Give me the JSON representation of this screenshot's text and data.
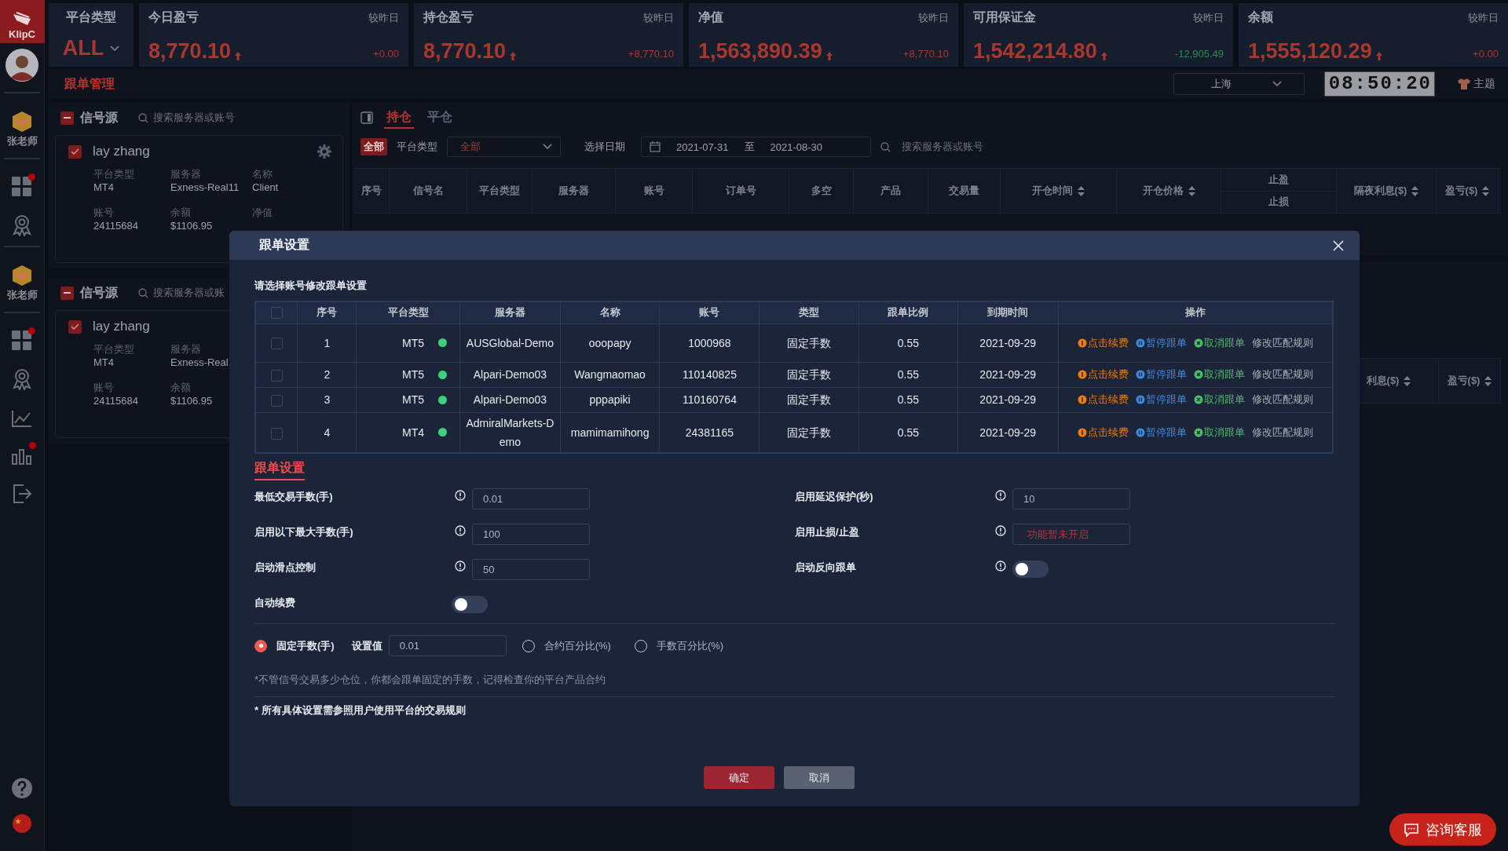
{
  "nav": {
    "logo": "KlipC",
    "items": [
      {
        "kind": "avatar"
      },
      {
        "kind": "teacher",
        "label": "张老师"
      },
      {
        "kind": "grid",
        "badge": true
      },
      {
        "kind": "award"
      },
      {
        "kind": "teacher",
        "label": "张老师"
      },
      {
        "kind": "grid",
        "badge": true
      },
      {
        "kind": "award"
      },
      {
        "kind": "chart"
      },
      {
        "kind": "bars",
        "badge": true
      },
      {
        "kind": "logout"
      }
    ],
    "bottom": [
      {
        "kind": "help"
      },
      {
        "kind": "flag"
      }
    ]
  },
  "platform_card": {
    "title": "平台类型",
    "value": "ALL"
  },
  "stats": [
    {
      "title": "今日盈亏",
      "compare": "较昨日",
      "value": "8,770.10",
      "rising": true,
      "delta": "+0.00",
      "delta_negative": false
    },
    {
      "title": "持仓盈亏",
      "compare": "较昨日",
      "value": "8,770.10",
      "rising": true,
      "delta": "+8,770.10",
      "delta_negative": false
    },
    {
      "title": "净值",
      "compare": "较昨日",
      "value": "1,563,890.39",
      "rising": true,
      "delta": "+8,770.10",
      "delta_negative": false
    },
    {
      "title": "可用保证金",
      "compare": "较昨日",
      "value": "1,542,214.80",
      "rising": true,
      "delta": "-12,905.49",
      "delta_negative": true
    },
    {
      "title": "余额",
      "compare": "较昨日",
      "value": "1,555,120.29",
      "rising": true,
      "delta": "+0.00",
      "delta_negative": false
    }
  ],
  "page_title": "跟单管理",
  "city_select": {
    "value": "上海"
  },
  "clock": "08:50:20",
  "theme": {
    "label": "主题"
  },
  "signal_panels": [
    {
      "title": "信号源",
      "indeterminate": true,
      "search_placeholder": "搜索服务器或账号",
      "card": {
        "name": "lay zhang",
        "checked": true,
        "settings": true,
        "rows": [
          [
            {
              "label": "平台类型",
              "value": "MT4"
            },
            {
              "label": "服务器",
              "value": "Exness-Real11"
            },
            {
              "label": "名称",
              "value": "Client"
            }
          ],
          [
            {
              "label": "账号",
              "value": "24115684"
            },
            {
              "label": "余额",
              "value": "$1106.95"
            },
            {
              "label": "净值"
            }
          ]
        ]
      }
    },
    {
      "title": "信号源",
      "indeterminate": true,
      "search_placeholder": "搜索服务器或账",
      "card": {
        "name": "lay zhang",
        "checked": true,
        "settings": false,
        "rows": [
          [
            {
              "label": "平台类型",
              "value": "MT4"
            },
            {
              "label": "服务器",
              "value": "Exness-Real"
            }
          ],
          [
            {
              "label": "账号",
              "value": "24115684"
            },
            {
              "label": "余额",
              "value": "$1106.95"
            }
          ]
        ]
      }
    }
  ],
  "positions": {
    "tabs": [
      {
        "label": "持仓",
        "selected": true
      },
      {
        "label": "平仓",
        "selected": false
      }
    ],
    "filter": {
      "all_badge": "全部",
      "platform_label": "平台类型",
      "platform_value": "全部",
      "date_label": "选择日期",
      "date_from": "2021-07-31",
      "date_sep": "至",
      "date_to": "2021-08-30",
      "search_placeholder": "搜索服务器或账号"
    },
    "columns": [
      {
        "kind": "plain",
        "label": "序号"
      },
      {
        "kind": "plain",
        "label": "信号名"
      },
      {
        "kind": "plain",
        "label": "平台类型"
      },
      {
        "kind": "plain",
        "label": "服务器"
      },
      {
        "kind": "plain",
        "label": "账号"
      },
      {
        "kind": "plain",
        "label": "订单号"
      },
      {
        "kind": "plain",
        "label": "多空"
      },
      {
        "kind": "plain",
        "label": "产品"
      },
      {
        "kind": "plain",
        "label": "交易量"
      },
      {
        "kind": "sort",
        "label": "开仓时间"
      },
      {
        "kind": "sort",
        "label": "开仓价格"
      },
      {
        "kind": "split",
        "labels": [
          "止盈",
          "止损"
        ]
      },
      {
        "kind": "sort",
        "label": "隔夜利息($)"
      },
      {
        "kind": "sort",
        "label": "盈亏($)"
      }
    ]
  },
  "positions_2": {
    "columns": [
      {
        "kind": "sort",
        "label": "利息($)"
      },
      {
        "kind": "sort",
        "label": "盈亏($)"
      }
    ]
  },
  "dialog": {
    "title": "跟单设置",
    "hint": "请选择账号修改跟单设置",
    "all_checked": false,
    "columns": [
      "序号",
      "平台类型",
      "服务器",
      "名称",
      "账号",
      "类型",
      "跟单比例",
      "到期时间",
      "操作"
    ],
    "rows": [
      {
        "checked": false,
        "index": "1",
        "platform": "MT5",
        "online": true,
        "server": "AUSGlobal-Demo",
        "name": "ooopapy",
        "account": "1000968",
        "type": "固定手数",
        "ratio": "0.55",
        "expiry": "2021-09-29",
        "actions": [
          {
            "kind": "renew",
            "label": "点击续费"
          },
          {
            "kind": "pause",
            "label": "暂停跟单"
          },
          {
            "kind": "cancel",
            "label": "取消跟单"
          },
          {
            "kind": "edit",
            "label": "修改匹配规则"
          }
        ]
      },
      {
        "checked": false,
        "index": "2",
        "platform": "MT5",
        "online": true,
        "server": "Alpari-Demo03",
        "name": "Wangmaomao",
        "account": "110140825",
        "type": "固定手数",
        "ratio": "0.55",
        "expiry": "2021-09-29",
        "actions": [
          {
            "kind": "renew",
            "label": "点击续费"
          },
          {
            "kind": "pause",
            "label": "暂停跟单"
          },
          {
            "kind": "cancel",
            "label": "取消跟单"
          },
          {
            "kind": "edit",
            "label": "修改匹配规则"
          }
        ]
      },
      {
        "checked": false,
        "index": "3",
        "platform": "MT5",
        "online": true,
        "server": "Alpari-Demo03",
        "name": "pppapiki",
        "account": "110160764",
        "type": "固定手数",
        "ratio": "0.55",
        "expiry": "2021-09-29",
        "actions": [
          {
            "kind": "renew",
            "label": "点击续费"
          },
          {
            "kind": "pause",
            "label": "暂停跟单"
          },
          {
            "kind": "cancel",
            "label": "取消跟单"
          },
          {
            "kind": "edit",
            "label": "修改匹配规则"
          }
        ]
      },
      {
        "checked": false,
        "index": "4",
        "platform": "MT4",
        "online": true,
        "server": "AdmiralMarkets-Demo",
        "name": "mamimamihong",
        "account": "24381165",
        "type": "固定手数",
        "ratio": "0.55",
        "expiry": "2021-09-29",
        "actions": [
          {
            "kind": "renew",
            "label": "点击续费"
          },
          {
            "kind": "pause",
            "label": "暂停跟单"
          },
          {
            "kind": "cancel",
            "label": "取消跟单"
          },
          {
            "kind": "edit",
            "label": "修改匹配规则"
          }
        ]
      }
    ],
    "section_title": "跟单设置",
    "settings": [
      {
        "kind": "input",
        "label": "最低交易手数(手)",
        "info": true,
        "value": "0.01"
      },
      {
        "kind": "input",
        "label": "启用延迟保护(秒)",
        "info": true,
        "value": "10"
      },
      {
        "kind": "input",
        "label": "启用以下最大手数(手)",
        "info": true,
        "value": "100"
      },
      {
        "kind": "notice",
        "label": "启用止损/止盈",
        "info": true,
        "value": "功能暂未开启"
      },
      {
        "kind": "input",
        "label": "启动滑点控制",
        "info": true,
        "value": "50"
      },
      {
        "kind": "toggle",
        "label": "启动反向跟单",
        "info": true,
        "on": false
      },
      {
        "kind": "toggle",
        "label": "自动续费",
        "info": false,
        "on": false
      }
    ],
    "mode": {
      "options": [
        {
          "label": "固定手数(手)",
          "selected": true,
          "input": {
            "label": "设置值",
            "value": "0.01"
          }
        },
        {
          "label": "合约百分比(%)",
          "selected": false
        },
        {
          "label": "手数百分比(%)",
          "selected": false
        }
      ]
    },
    "note": "*不管信号交易多少仓位，你都会跟单固定的手数，记得检查你的平台产品合约",
    "footnote": "* 所有具体设置需参照用户使用平台的交易规则",
    "buttons": [
      {
        "kind": "primary",
        "label": "确定"
      },
      {
        "kind": "secondary",
        "label": "取消"
      }
    ]
  },
  "support_button": {
    "label": "咨询客服"
  }
}
